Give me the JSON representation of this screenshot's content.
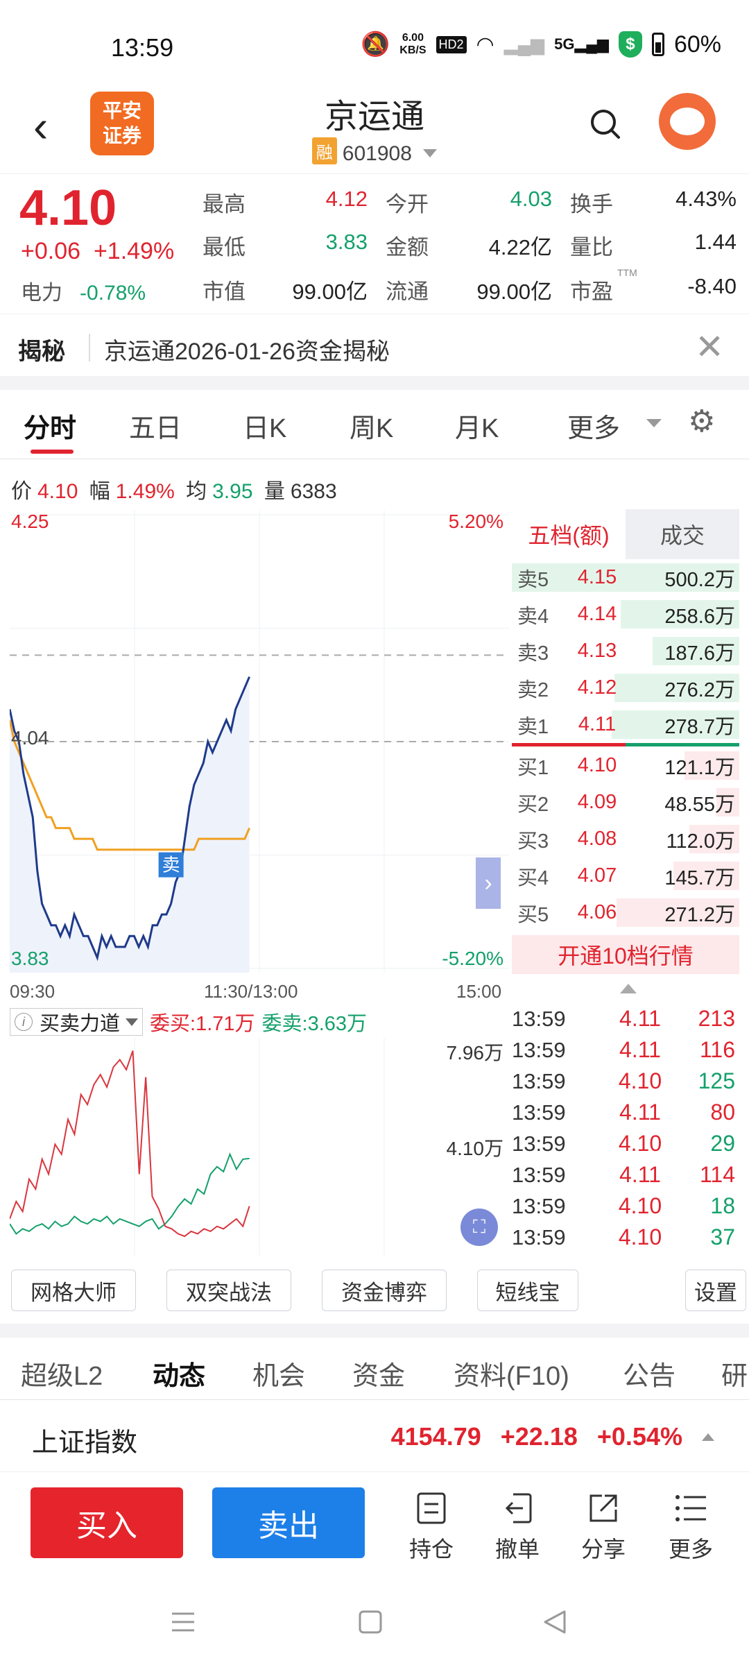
{
  "status": {
    "time": "13:59",
    "net_speed_top": "6.00",
    "net_speed_unit": "KB/S",
    "hd": "HD2",
    "five_g": "5G",
    "shield_char": "$",
    "battery": "60%"
  },
  "header": {
    "logo_line1": "平安",
    "logo_line2": "证券",
    "stock_name": "京运通",
    "margin_tag": "融",
    "stock_code": "601908"
  },
  "quote": {
    "price": "4.10",
    "change": "+0.06",
    "change_pct": "+1.49%",
    "sector_name": "电力",
    "sector_pct": "-0.78%",
    "cells": [
      {
        "label": "最高",
        "value": "4.12",
        "color": "red"
      },
      {
        "label": "今开",
        "value": "4.03",
        "color": "green"
      },
      {
        "label": "换手",
        "value": "4.43%",
        "color": "dark"
      },
      {
        "label": "最低",
        "value": "3.83",
        "color": "green"
      },
      {
        "label": "金额",
        "value": "4.22亿",
        "color": "dark"
      },
      {
        "label": "量比",
        "value": "1.44",
        "color": "dark"
      },
      {
        "label": "市值",
        "value": "99.00亿",
        "color": "dark"
      },
      {
        "label": "流通",
        "value": "99.00亿",
        "color": "dark"
      },
      {
        "label": "市盈",
        "value": "-8.40",
        "color": "dark"
      }
    ],
    "ttm": "TTM"
  },
  "reveal": {
    "tag": "揭秘",
    "text": "京运通2026-01-26资金揭秘"
  },
  "tabs": [
    "分时",
    "五日",
    "日K",
    "周K",
    "月K",
    "更多"
  ],
  "info_line": {
    "price_label": "价",
    "price": "4.10",
    "amp_label": "幅",
    "amp": "1.49%",
    "avg_label": "均",
    "avg": "3.95",
    "vol_label": "量",
    "vol": "6383"
  },
  "chart_data": {
    "type": "line",
    "y_left_ticks": [
      "4.25",
      "4.04",
      "3.83"
    ],
    "y_right_ticks": [
      "5.20%",
      "-5.20%"
    ],
    "x_ticks": [
      "09:30",
      "11:30/13:00",
      "15:00"
    ],
    "ylim": [
      3.83,
      4.25
    ],
    "prev_close": 4.04,
    "price_series": [
      4.07,
      4.05,
      4.04,
      4.01,
      3.99,
      3.97,
      3.92,
      3.89,
      3.88,
      3.87,
      3.87,
      3.86,
      3.87,
      3.86,
      3.88,
      3.87,
      3.86,
      3.86,
      3.85,
      3.84,
      3.86,
      3.85,
      3.86,
      3.85,
      3.85,
      3.85,
      3.86,
      3.86,
      3.85,
      3.86,
      3.85,
      3.87,
      3.87,
      3.88,
      3.88,
      3.89,
      3.91,
      3.92,
      3.95,
      3.98,
      4.0,
      4.01,
      4.02,
      4.04,
      4.03,
      4.04,
      4.05,
      4.06,
      4.05,
      4.07,
      4.08,
      4.09,
      4.1
    ],
    "avg_series": [
      4.06,
      4.04,
      4.03,
      4.02,
      4.01,
      4.0,
      3.99,
      3.98,
      3.97,
      3.97,
      3.96,
      3.96,
      3.96,
      3.96,
      3.95,
      3.95,
      3.95,
      3.95,
      3.95,
      3.94,
      3.94,
      3.94,
      3.94,
      3.94,
      3.94,
      3.94,
      3.94,
      3.94,
      3.94,
      3.94,
      3.94,
      3.94,
      3.94,
      3.94,
      3.94,
      3.94,
      3.94,
      3.94,
      3.94,
      3.94,
      3.94,
      3.95,
      3.95,
      3.95,
      3.95,
      3.95,
      3.95,
      3.95,
      3.95,
      3.95,
      3.95,
      3.95,
      3.96
    ],
    "sell_marker": "卖"
  },
  "orderbook": {
    "tab_active": "五档(额)",
    "tab_other": "成交",
    "asks": [
      {
        "label": "卖5",
        "price": "4.15",
        "vol": "500.2万",
        "frac": 1.0
      },
      {
        "label": "卖4",
        "price": "4.14",
        "vol": "258.6万",
        "frac": 0.52
      },
      {
        "label": "卖3",
        "price": "4.13",
        "vol": "187.6万",
        "frac": 0.38
      },
      {
        "label": "卖2",
        "price": "4.12",
        "vol": "276.2万",
        "frac": 0.55
      },
      {
        "label": "卖1",
        "price": "4.11",
        "vol": "278.7万",
        "frac": 0.56
      }
    ],
    "bids": [
      {
        "label": "买1",
        "price": "4.10",
        "vol": "121.1万",
        "frac": 0.24
      },
      {
        "label": "买2",
        "price": "4.09",
        "vol": "48.55万",
        "frac": 0.1
      },
      {
        "label": "买3",
        "price": "4.08",
        "vol": "112.0万",
        "frac": 0.22
      },
      {
        "label": "买4",
        "price": "4.07",
        "vol": "145.7万",
        "frac": 0.29
      },
      {
        "label": "买5",
        "price": "4.06",
        "vol": "271.2万",
        "frac": 0.54
      }
    ],
    "open10": "开通10档行情"
  },
  "trades": [
    {
      "time": "13:59",
      "price": "4.11",
      "vol": "213",
      "color": "red"
    },
    {
      "time": "13:59",
      "price": "4.11",
      "vol": "116",
      "color": "red"
    },
    {
      "time": "13:59",
      "price": "4.10",
      "vol": "125",
      "color": "green"
    },
    {
      "time": "13:59",
      "price": "4.11",
      "vol": "80",
      "color": "red"
    },
    {
      "time": "13:59",
      "price": "4.10",
      "vol": "29",
      "color": "green"
    },
    {
      "time": "13:59",
      "price": "4.11",
      "vol": "114",
      "color": "red"
    },
    {
      "time": "13:59",
      "price": "4.10",
      "vol": "18",
      "color": "green"
    },
    {
      "time": "13:59",
      "price": "4.10",
      "vol": "37",
      "color": "green"
    }
  ],
  "power": {
    "selector": "买卖力道",
    "buy_label": "委买:1.71万",
    "sell_label": "委卖:3.63万",
    "tick_top": "7.96万",
    "tick_mid": "4.10万",
    "buy_series": [
      1.2,
      1.9,
      1.5,
      2.8,
      2.4,
      3.6,
      3.0,
      4.2,
      3.8,
      5.2,
      4.6,
      6.2,
      5.8,
      6.6,
      7.0,
      6.5,
      7.3,
      7.6,
      7.2,
      7.96,
      3.0,
      6.9,
      2.1,
      1.6,
      0.9,
      0.8,
      0.6,
      0.5,
      0.7,
      0.6,
      0.8,
      0.7,
      0.9,
      0.8,
      1.0,
      1.2,
      0.9,
      1.71
    ],
    "sell_series": [
      1.0,
      0.6,
      0.8,
      0.7,
      0.9,
      1.0,
      0.8,
      1.1,
      0.9,
      1.0,
      1.3,
      1.1,
      1.0,
      1.2,
      1.1,
      1.3,
      1.0,
      1.2,
      1.1,
      1.0,
      0.9,
      1.1,
      1.2,
      0.8,
      1.0,
      1.3,
      1.7,
      2.0,
      1.8,
      2.4,
      2.2,
      3.0,
      3.3,
      3.1,
      3.8,
      3.2,
      3.6,
      3.63
    ]
  },
  "tools": [
    "网格大师",
    "双突战法",
    "资金博弈",
    "短线宝",
    "设置"
  ],
  "bottom_tabs": [
    "超级L2",
    "动态",
    "机会",
    "资金",
    "资料(F10)",
    "公告",
    "研"
  ],
  "index": {
    "name": "上证指数",
    "value": "4154.79",
    "change": "+22.18",
    "pct": "+0.54%"
  },
  "actions": {
    "buy": "买入",
    "sell": "卖出",
    "items": [
      "持仓",
      "撤单",
      "分享",
      "更多"
    ]
  }
}
